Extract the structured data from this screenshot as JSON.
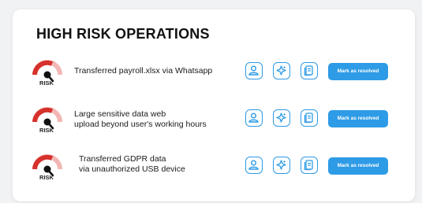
{
  "header": {
    "title": "HIGH RISK OPERATIONS"
  },
  "operations": [
    {
      "risk_label": "RISK",
      "lines": [
        "Transferred payroll.xlsx via Whatsapp"
      ],
      "action_label": "Mark as resolved"
    },
    {
      "risk_label": "RISK",
      "lines": [
        "Large sensitive data web",
        "upload beyond user's working hours"
      ],
      "action_label": "Mark as resolved"
    },
    {
      "risk_label": "RISK",
      "lines": [
        "Transferred GDPR data",
        "via unauthorized USB device"
      ],
      "action_label": "Mark as resolved"
    }
  ],
  "icons": [
    "user-icon",
    "sparkle-icon",
    "document-icon"
  ],
  "colors": {
    "accent": "#2e9be6",
    "risk": "#d6312c",
    "risk_light": "#f2b7b4"
  }
}
